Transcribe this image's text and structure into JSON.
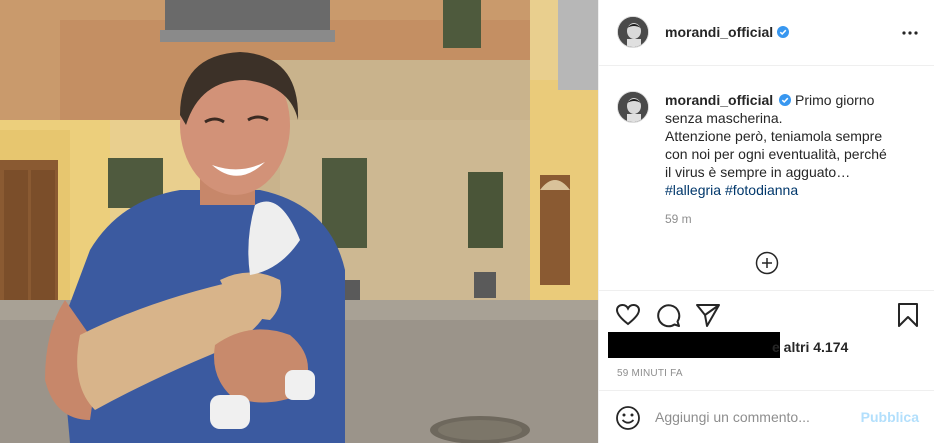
{
  "post": {
    "username": "morandi_official",
    "verified_icon": "verified-badge-icon",
    "caption_text_lines": [
      "Primo giorno",
      "senza mascherina.",
      "Attenzione però, teniamola sempre",
      "con noi per ogni eventualità, perché",
      "il virus è sempre in agguato…"
    ],
    "hashtags": [
      "#lallegria",
      "#fotodianna"
    ],
    "time_ago": "59 m",
    "likes_text": "e altri 4.174",
    "date": "59 MINUTI FA"
  },
  "comment": {
    "placeholder": "Aggiungi un commento...",
    "post_label": "Pubblica"
  },
  "icons": {
    "more": "more-options-icon",
    "add": "add-circle-icon",
    "like": "heart-icon",
    "comment": "comment-icon",
    "share": "share-icon",
    "save": "bookmark-icon",
    "emoji": "emoji-icon"
  },
  "colors": {
    "verified": "#3897f0",
    "hashtag": "#00376b",
    "muted": "#8e8e8e",
    "post_button": "#b2dffc",
    "shirt": "#3a5a9e",
    "wall": "#e6c98a"
  }
}
